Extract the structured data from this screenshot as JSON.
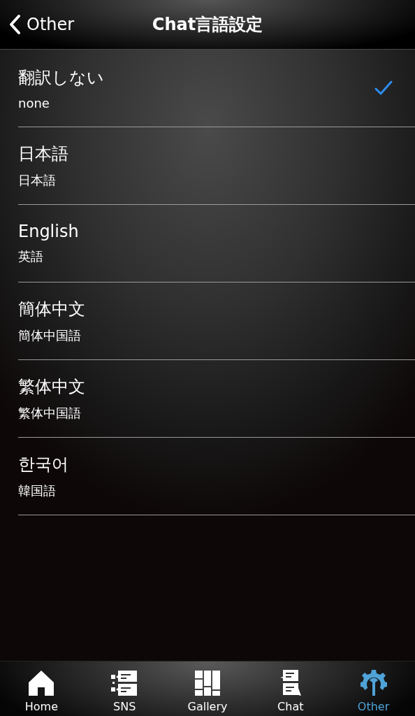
{
  "header": {
    "back_label": "Other",
    "title": "Chat言語設定"
  },
  "languages": [
    {
      "name": "翻訳しない",
      "subtitle": "none",
      "selected": true
    },
    {
      "name": "日本語",
      "subtitle": "日本語",
      "selected": false
    },
    {
      "name": "English",
      "subtitle": "英語",
      "selected": false
    },
    {
      "name": "簡体中文",
      "subtitle": "簡体中国語",
      "selected": false
    },
    {
      "name": "繁体中文",
      "subtitle": "繁体中国語",
      "selected": false
    },
    {
      "name": "한국어",
      "subtitle": "韓国語",
      "selected": false
    }
  ],
  "tab_bar": [
    {
      "label": "Home",
      "kind": "home",
      "selected": false
    },
    {
      "label": "SNS",
      "kind": "sns",
      "selected": false
    },
    {
      "label": "Gallery",
      "kind": "gallery",
      "selected": false
    },
    {
      "label": "Chat",
      "kind": "chat",
      "selected": false
    },
    {
      "label": "Other",
      "kind": "other",
      "selected": true
    }
  ]
}
